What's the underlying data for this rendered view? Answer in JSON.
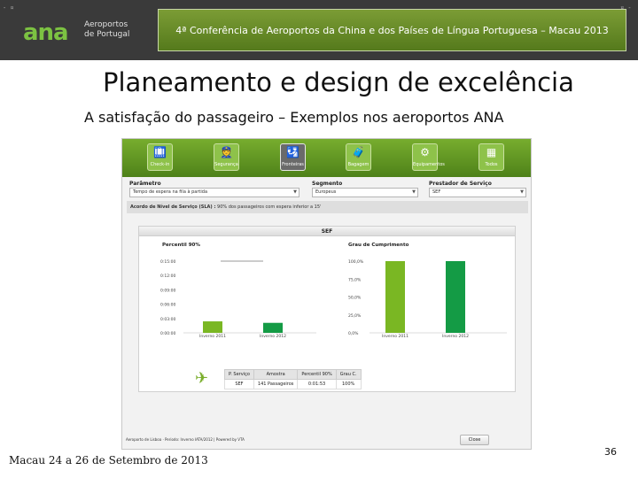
{
  "header": {
    "logo_mark": "ana",
    "logo_text": "Aeroportos de Portugal",
    "conference": "4ª Conferência de Aeroportos da China e dos Países de Língua Portuguesa – Macau 2013",
    "brand_color": "#7cc242",
    "header_bg": "#3a3a3a"
  },
  "title": "Planeamento e design de excelência",
  "subtitle": "A satisfação do passageiro – Exemplos nos aeroportos ANA",
  "app": {
    "tiles": [
      {
        "label": "Check-in",
        "icon": "check-in-icon"
      },
      {
        "label": "Segurança",
        "icon": "security-icon"
      },
      {
        "label": "Fronteiras",
        "icon": "passport-icon",
        "active": true
      },
      {
        "label": "Bagagem",
        "icon": "baggage-icon"
      },
      {
        "label": "Equipamentos",
        "icon": "equipment-icon"
      },
      {
        "label": "Todos",
        "icon": "all-icon"
      }
    ],
    "filters": {
      "parametro": {
        "label": "Parâmetro",
        "value": "Tempo de espera na fila à partida"
      },
      "segmento": {
        "label": "Segmento",
        "value": "Europeus"
      },
      "prestador": {
        "label": "Prestador de Serviço",
        "value": "SEF"
      }
    },
    "sla": {
      "label": "Acordo de Nível de Serviço (SLA) :",
      "value": "90% dos passageiros com espera inferior a 15'"
    },
    "panel_title": "SEF",
    "footer_text": "Aeroporto de Lisboa · Periodo: Inverno IATA/2012 | Powered by VTA",
    "close_button": "Close"
  },
  "chart_data": [
    {
      "type": "bar",
      "title": "Percentil 90%",
      "categories": [
        "Inverno 2011",
        "Inverno 2012"
      ],
      "values": [
        0.04,
        0.0348
      ],
      "yticks": [
        "0:15:00",
        "0:12:00",
        "0:09:00",
        "0:06:00",
        "0:03:00",
        "0:00:00"
      ],
      "ylim": [
        0,
        0.25
      ],
      "target_line": 0.25,
      "colors": [
        "#7ab723",
        "#149b45"
      ]
    },
    {
      "type": "bar",
      "title": "Grau de Cumprimento",
      "categories": [
        "Inverno 2011",
        "Inverno 2012"
      ],
      "values": [
        100,
        100
      ],
      "yticks": [
        "100,0%",
        "75,0%",
        "50,0%",
        "25,0%",
        "0,0%"
      ],
      "ylim": [
        0,
        100
      ],
      "colors": [
        "#7ab723",
        "#149b45"
      ]
    }
  ],
  "table": {
    "headers": [
      "P. Serviço",
      "Amostra",
      "Percentil 90%",
      "Grau C."
    ],
    "rows": [
      [
        "SEF",
        "141 Passageiros",
        "0:01:53",
        "100%"
      ]
    ]
  },
  "footer": {
    "date": "Macau 24 a 26 de Setembro de 2013",
    "page": "36"
  }
}
